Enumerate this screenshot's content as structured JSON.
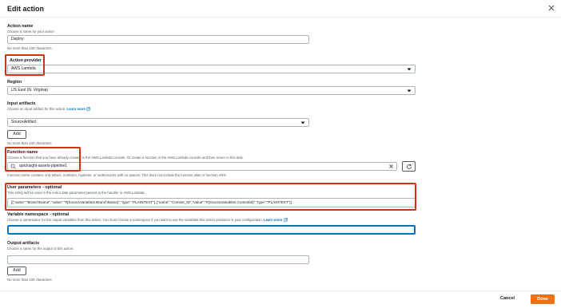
{
  "dialog": {
    "title": "Edit action",
    "close_icon": "close-icon"
  },
  "action_name": {
    "label": "Action name",
    "description": "Choose a name for your action",
    "value": "Deploy",
    "hint": "No more than 100 characters"
  },
  "action_provider": {
    "label": "Action provider",
    "value": "AWS Lambda"
  },
  "region": {
    "label": "Region",
    "value": "US East (N. Virginia)"
  },
  "input_artifacts": {
    "label": "Input artifacts",
    "description": "Choose an input artifact for this action.",
    "learn_more": "Learn more",
    "value": "SourceArtifact",
    "add_button": "Add",
    "hint": "No more than 100 characters"
  },
  "function_name": {
    "label": "Function name",
    "description": "Choose a function that you have already created in the AWS Lambda console. Or create a function in the AWS Lambda console and then return to this task.",
    "value": "quicksight-assets-pipeline1",
    "hint": "Function name contains only letters, numbers, hyphens, or underscores with no spaces. This does not include the function alias or function ARN."
  },
  "user_parameters": {
    "label": "User parameters - optional",
    "description": "This string will be used in the event data parameter passed to the handler in AWS Lambda.",
    "value": "[{\"name\":\"BranchName\",\"value\":\"#{SourceVariables.BranchName}\",\"type\":\"PLAINTEXT\"},{\"name\":\"Commit_ID\",\"value\":\"#{SourceVariables.CommitId}\",\"type\":\"PLAINTEXT\"}]"
  },
  "variable_namespace": {
    "label": "Variable namespace - optional",
    "description": "Choose a namespace for the output variables from this action. You must choose a namespace if you want to use the variables this action produces in your configuration.",
    "learn_more": "Learn more",
    "value": ""
  },
  "output_artifacts": {
    "label": "Output artifacts",
    "description": "Choose a name for the output of this action.",
    "value": "",
    "add_button": "Add",
    "hint": "No more than 100 characters"
  },
  "footer": {
    "cancel": "Cancel",
    "done": "Done"
  },
  "colors": {
    "accent": "#ec7211",
    "link": "#0073bb",
    "highlight": "#d13212"
  }
}
